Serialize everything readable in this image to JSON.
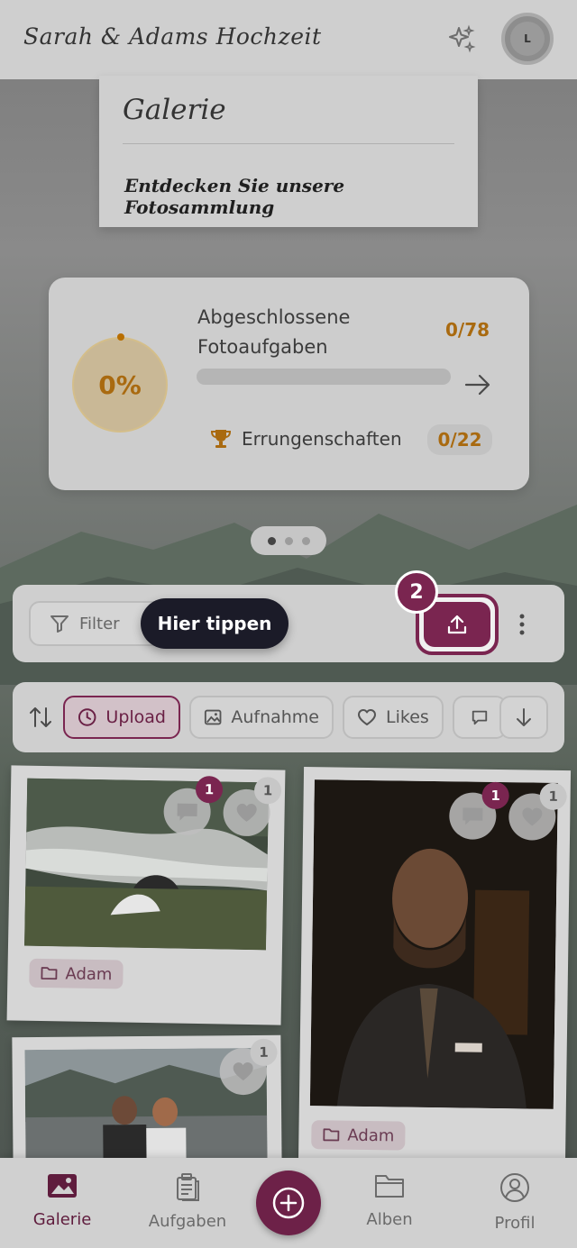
{
  "header": {
    "title": "Sarah & Adams Hochzeit",
    "avatar_initial": "L",
    "icons": [
      "sparkle-icon"
    ]
  },
  "gallery": {
    "title": "Galerie",
    "subtitle": "Entdecken Sie unsere Fotosammlung"
  },
  "progress": {
    "percent_label": "0%",
    "tasks_label": "Abgeschlossene Fotoaufgaben",
    "tasks_count": "0/78",
    "tasks_progress": 0,
    "achievements_label": "Errungenschaften",
    "achievements_count": "0/22"
  },
  "pager": {
    "pages": 3,
    "active": 0
  },
  "filter_bar": {
    "filter_label": "Filter",
    "tooltip": "Hier tippen",
    "step_number": "2"
  },
  "sort_bar": {
    "chips": [
      {
        "label": "Upload",
        "icon": "clock-icon",
        "active": true
      },
      {
        "label": "Aufnahme",
        "icon": "image-icon",
        "active": false
      },
      {
        "label": "Likes",
        "icon": "heart-icon",
        "active": false
      }
    ]
  },
  "photos": [
    {
      "album": "Adam",
      "comments": "1",
      "likes": "1"
    },
    {
      "album": "Adam",
      "comments": "1",
      "likes": "1"
    },
    {
      "likes": "1"
    }
  ],
  "nav": {
    "items": [
      {
        "label": "Galerie",
        "icon": "gallery-icon",
        "active": true
      },
      {
        "label": "Aufgaben",
        "icon": "clipboard-icon",
        "active": false
      },
      {
        "label": "Alben",
        "icon": "folder-icon",
        "active": false
      },
      {
        "label": "Profil",
        "icon": "profile-icon",
        "active": false
      }
    ]
  },
  "colors": {
    "accent": "#7a2550",
    "gold": "#a96a10",
    "tooltip_bg": "#1b1b28"
  }
}
